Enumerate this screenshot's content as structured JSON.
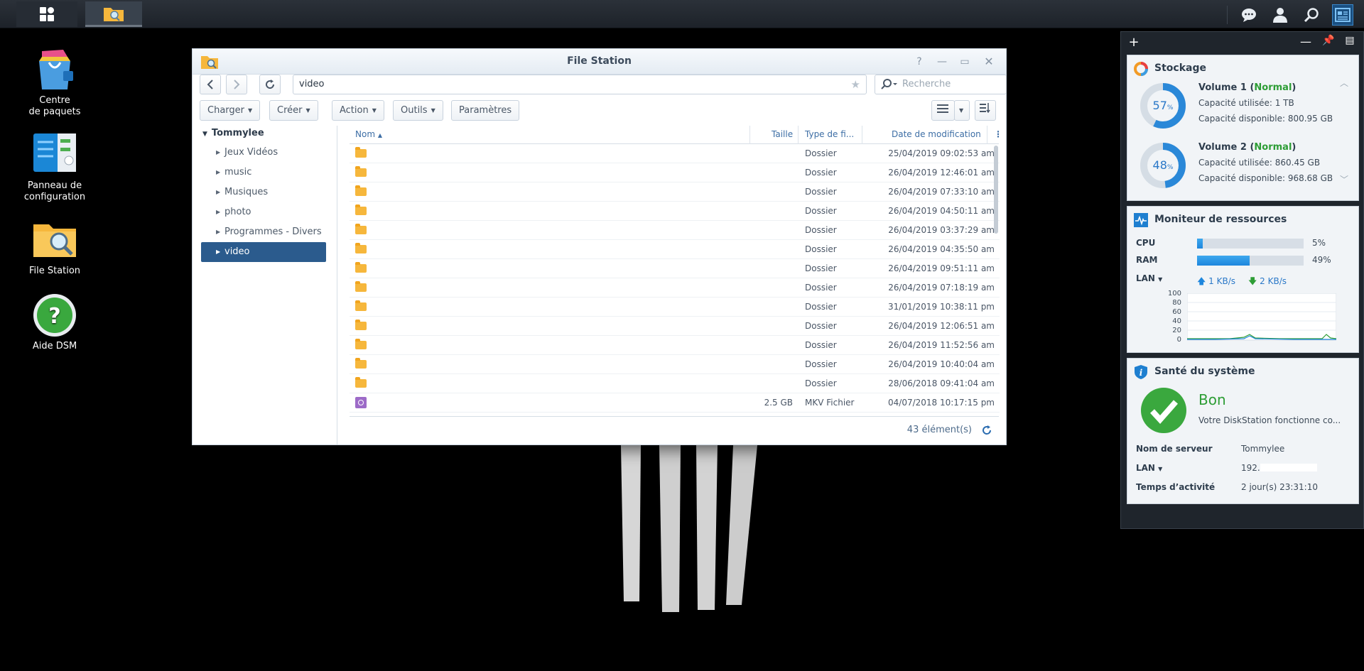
{
  "taskbar": {
    "main_menu_icon": "grid-icon",
    "filestation_icon": "folder-search-icon",
    "right_icons": [
      "chat-icon",
      "user-icon",
      "search-icon",
      "widgets-icon"
    ]
  },
  "desktop": {
    "icons": [
      {
        "label_line1": "Centre",
        "label_line2": "de paquets",
        "icon": "package-center-icon"
      },
      {
        "label_line1": "Panneau de",
        "label_line2": "configuration",
        "icon": "control-panel-icon"
      },
      {
        "label_line1": "File Station",
        "label_line2": "",
        "icon": "file-station-icon"
      },
      {
        "label_line1": "Aide DSM",
        "label_line2": "",
        "icon": "help-icon"
      }
    ]
  },
  "filestation": {
    "title": "File Station",
    "path": "video",
    "search_placeholder": "Recherche",
    "toolbar": {
      "upload": "Charger",
      "create": "Créer",
      "action": "Action",
      "tools": "Outils",
      "settings": "Paramètres"
    },
    "tree": {
      "root": "Tommylee",
      "items": [
        "Jeux Vidéos",
        "music",
        "Musiques",
        "photo",
        "Programmes - Divers",
        "video"
      ],
      "selected": "video"
    },
    "columns": {
      "name": "Nom",
      "size": "Taille",
      "type": "Type de fi...",
      "modified": "Date de modification"
    },
    "rows": [
      {
        "icon": "folder",
        "size": "",
        "type": "Dossier",
        "modified": "25/04/2019 09:02:53 am"
      },
      {
        "icon": "folder",
        "size": "",
        "type": "Dossier",
        "modified": "26/04/2019 12:46:01 am"
      },
      {
        "icon": "folder",
        "size": "",
        "type": "Dossier",
        "modified": "26/04/2019 07:33:10 am"
      },
      {
        "icon": "folder",
        "size": "",
        "type": "Dossier",
        "modified": "26/04/2019 04:50:11 am"
      },
      {
        "icon": "folder",
        "size": "",
        "type": "Dossier",
        "modified": "26/04/2019 03:37:29 am"
      },
      {
        "icon": "folder",
        "size": "",
        "type": "Dossier",
        "modified": "26/04/2019 04:35:50 am"
      },
      {
        "icon": "folder",
        "size": "",
        "type": "Dossier",
        "modified": "26/04/2019 09:51:11 am"
      },
      {
        "icon": "folder",
        "size": "",
        "type": "Dossier",
        "modified": "26/04/2019 07:18:19 am"
      },
      {
        "icon": "folder",
        "size": "",
        "type": "Dossier",
        "modified": "31/01/2019 10:38:11 pm"
      },
      {
        "icon": "folder",
        "size": "",
        "type": "Dossier",
        "modified": "26/04/2019 12:06:51 am"
      },
      {
        "icon": "folder",
        "size": "",
        "type": "Dossier",
        "modified": "26/04/2019 11:52:56 am"
      },
      {
        "icon": "folder",
        "size": "",
        "type": "Dossier",
        "modified": "26/04/2019 10:40:04 am"
      },
      {
        "icon": "folder",
        "size": "",
        "type": "Dossier",
        "modified": "28/06/2018 09:41:04 am"
      },
      {
        "icon": "mkv",
        "size": "2.5 GB",
        "type": "MKV Fichier",
        "modified": "04/07/2018 10:17:15 pm"
      }
    ],
    "item_count": "43 élément(s)"
  },
  "widgets": {
    "storage": {
      "title": "Stockage",
      "volumes": [
        {
          "name": "Volume 1",
          "status": "Normal",
          "percent": 57,
          "percent_text": "57",
          "used": "Capacité utilisée: 1 TB",
          "free": "Capacité disponible: 800.95 GB"
        },
        {
          "name": "Volume 2",
          "status": "Normal",
          "percent": 48,
          "percent_text": "48",
          "used": "Capacité utilisée: 860.45 GB",
          "free": "Capacité disponible: 968.68 GB"
        }
      ]
    },
    "resources": {
      "title": "Moniteur de ressources",
      "cpu_label": "CPU",
      "cpu_value": 5,
      "cpu_text": "5%",
      "ram_label": "RAM",
      "ram_value": 49,
      "ram_text": "49%",
      "lan_label": "LAN",
      "lan_up": "1 KB/s",
      "lan_down": "2 KB/s",
      "yticks": [
        "100",
        "80",
        "60",
        "40",
        "20",
        "0"
      ]
    },
    "health": {
      "title": "Santé du système",
      "status": "Bon",
      "message": "Votre DiskStation fonctionne co...",
      "server_name_label": "Nom de serveur",
      "server_name": "Tommylee",
      "lan_label": "LAN",
      "lan_value": "192.",
      "uptime_label": "Temps d’activité",
      "uptime": "2 jour(s) 23:31:10"
    }
  },
  "colors": {
    "selection": "#2b5b8d",
    "accent_blue": "#2a78c8",
    "status_green": "#2d9d35",
    "folder": "#f6b73c"
  }
}
